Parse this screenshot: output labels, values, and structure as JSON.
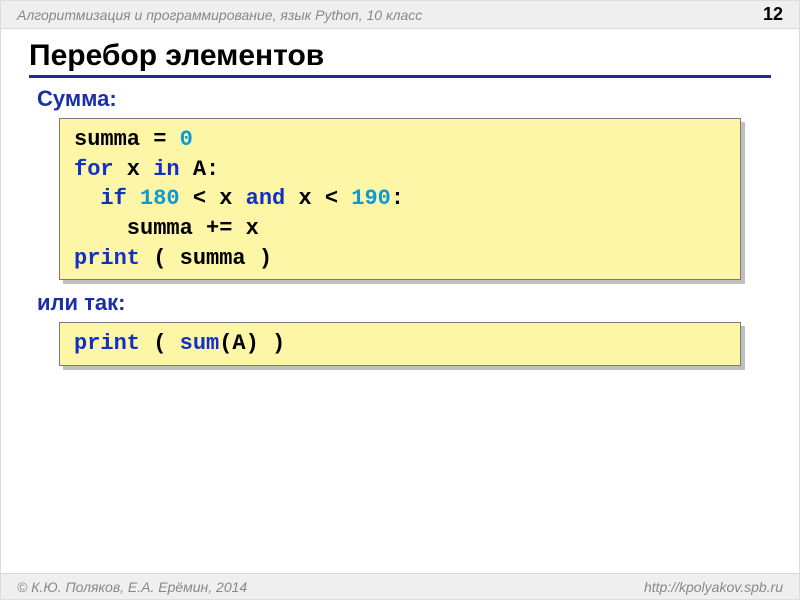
{
  "header": {
    "course": "Алгоритмизация и программирование, язык Python, 10 класс",
    "page": "12"
  },
  "title": "Перебор элементов",
  "labels": {
    "sum": "Сумма:",
    "or": "или так:"
  },
  "code1": {
    "l1a": "summa = ",
    "l1n": "0",
    "l2a": "for",
    "l2b": " x ",
    "l2c": "in",
    "l2d": " A:",
    "l3a": "  ",
    "l3b": "if",
    "l3c": " ",
    "l3n1": "180",
    "l3d": " < x ",
    "l3e": "and",
    "l3f": " x < ",
    "l3n2": "190",
    "l3g": ":",
    "l4": "    summa += x",
    "l5a": "print",
    "l5b": " ( summa )"
  },
  "code2": {
    "a": "print",
    "b": " ( ",
    "c": "sum",
    "d": "(A) )"
  },
  "footer": {
    "author": "© К.Ю. Поляков, Е.А. Ерёмин, 2014",
    "url": "http://kpolyakov.spb.ru"
  }
}
